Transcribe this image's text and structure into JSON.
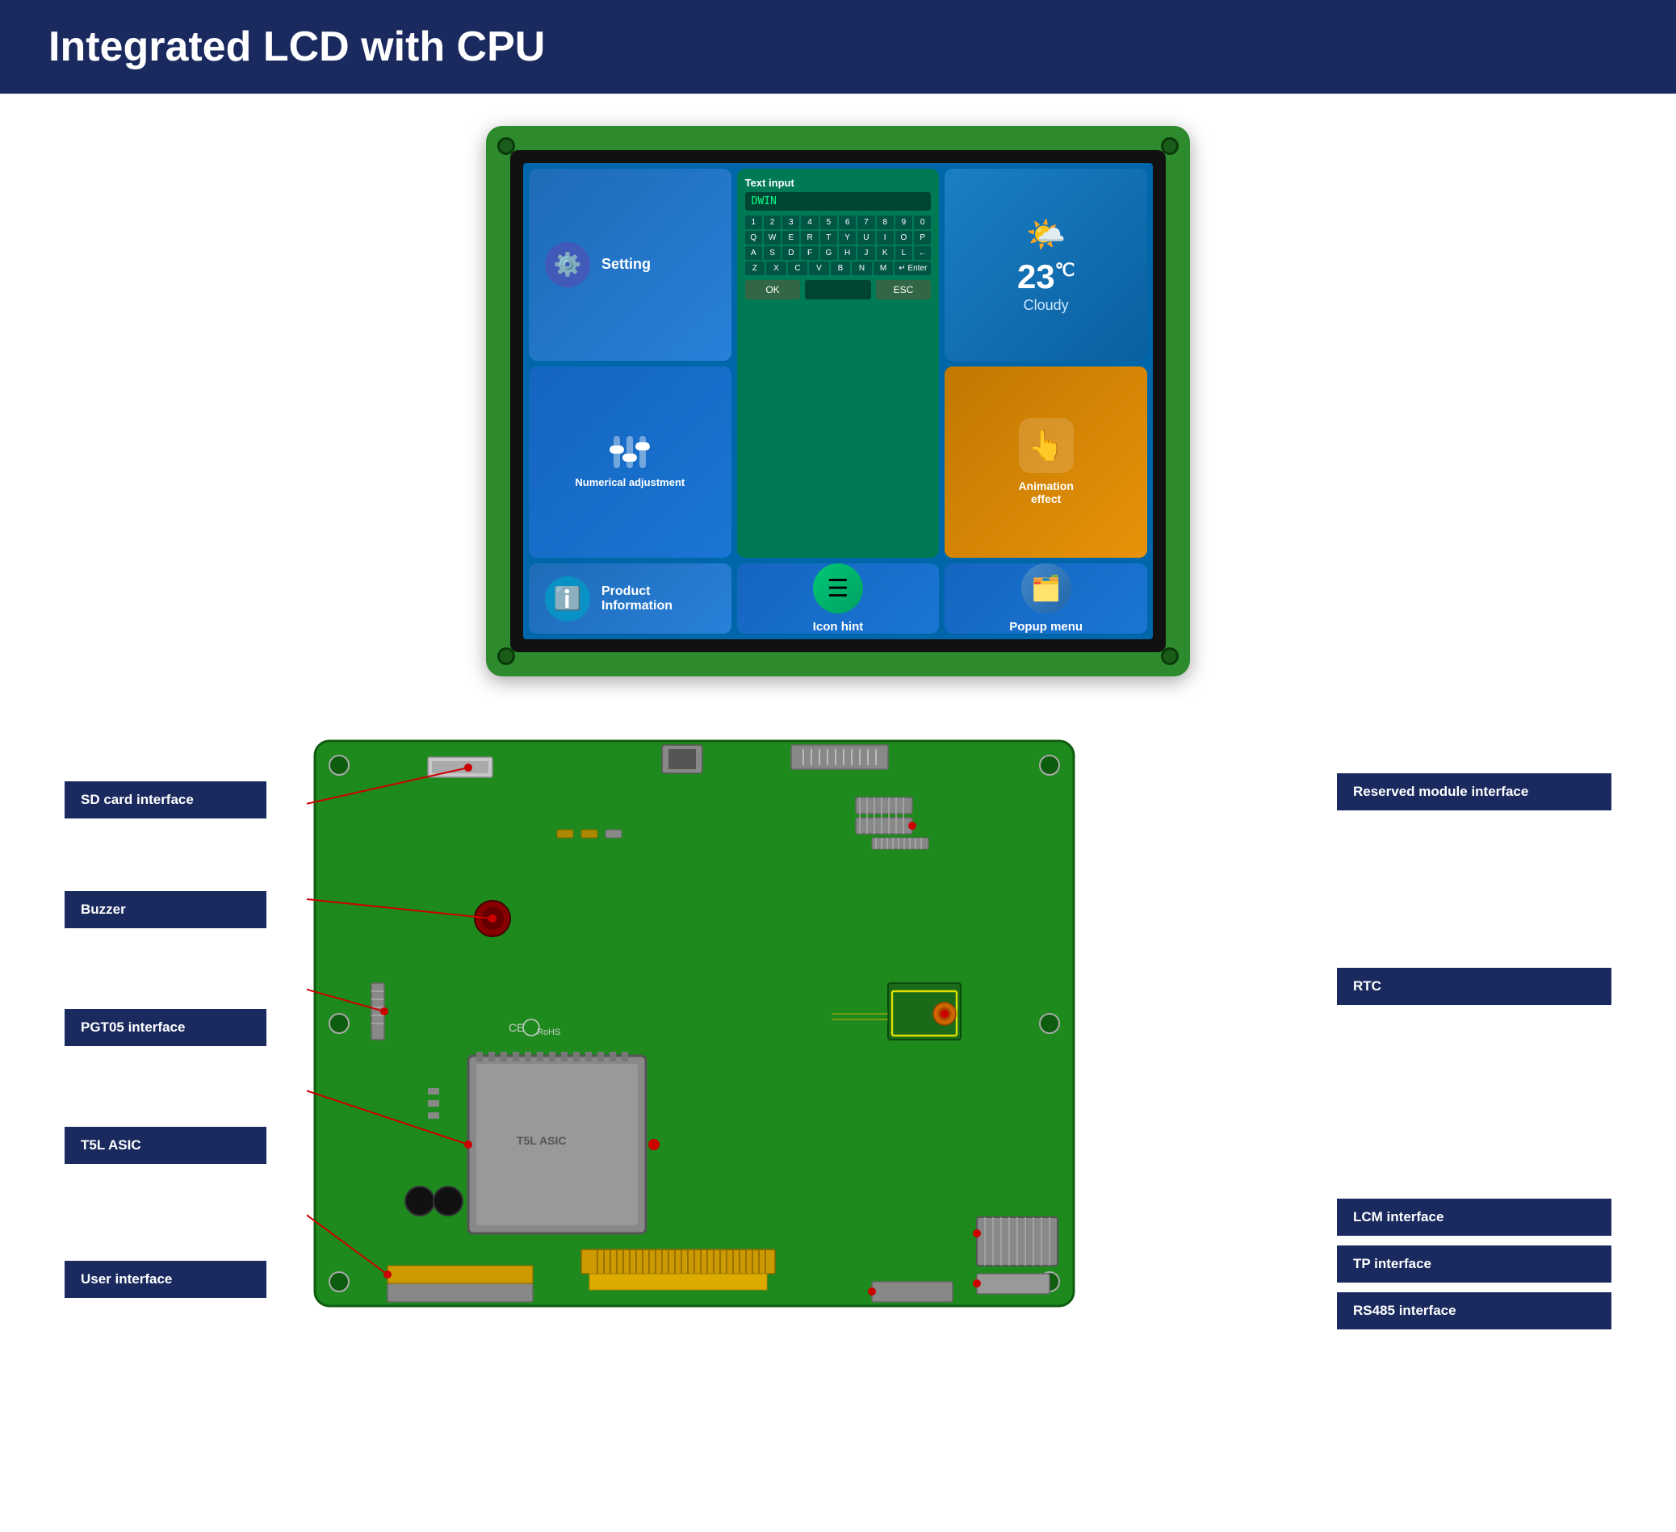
{
  "header": {
    "title": "Integrated LCD with CPU",
    "bg_color": "#1a2a5e"
  },
  "lcd_screen": {
    "tiles": {
      "setting": {
        "label": "Setting"
      },
      "product_info": {
        "label": "Product\nInformation"
      },
      "keyboard": {
        "title": "Text input",
        "value": "DWIN",
        "rows": [
          [
            "1",
            "2",
            "3",
            "4",
            "5",
            "6",
            "7",
            "8",
            "9",
            "0"
          ],
          [
            "Q",
            "W",
            "E",
            "R",
            "T",
            "Y",
            "U",
            "I",
            "O",
            "P"
          ],
          [
            "A",
            "S",
            "D",
            "F",
            "G",
            "H",
            "J",
            "K",
            "L",
            "←"
          ],
          [
            "Z",
            "X",
            "C",
            "V",
            "B",
            "N",
            "M",
            "↵ Enter"
          ],
          [
            "OK",
            "",
            "ESC"
          ]
        ]
      },
      "weather": {
        "temp": "23",
        "unit": "℃",
        "desc": "Cloudy"
      },
      "numerical": {
        "label": "Numerical adjustment"
      },
      "icon_hint": {
        "label": "Icon hint"
      },
      "popup_menu": {
        "label": "Popup menu"
      },
      "animation": {
        "label": "Animation\neffect"
      }
    }
  },
  "pcb_section": {
    "left_labels": [
      {
        "id": "sd-card",
        "text": "SD card interface"
      },
      {
        "id": "buzzer",
        "text": "Buzzer"
      },
      {
        "id": "pgt05",
        "text": "PGT05 interface"
      },
      {
        "id": "t5l-asic",
        "text": "T5L ASIC"
      },
      {
        "id": "user-interface",
        "text": "User interface"
      }
    ],
    "right_labels": [
      {
        "id": "reserved-module",
        "text": "Reserved module interface"
      },
      {
        "id": "rtc",
        "text": "RTC"
      },
      {
        "id": "lcm",
        "text": "LCM interface"
      },
      {
        "id": "tp",
        "text": "TP interface"
      },
      {
        "id": "rs485",
        "text": "RS485 interface"
      }
    ]
  }
}
